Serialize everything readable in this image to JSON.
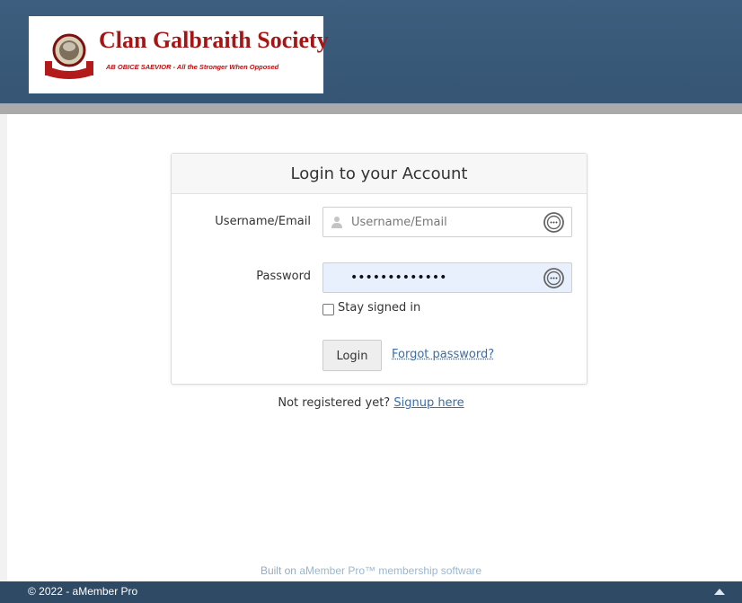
{
  "site": {
    "name": "Clan Galbraith Society",
    "motto": "AB OBICE SAEVIOR - All the Stronger When Opposed"
  },
  "login": {
    "title": "Login to your Account",
    "username_label": "Username/Email",
    "username_placeholder": "Username/Email",
    "password_label": "Password",
    "password_value": "•••••••••••••",
    "stay_signed_in": "Stay signed in",
    "login_button": "Login",
    "forgot_link": "Forgot password?"
  },
  "signup": {
    "prompt": "Not registered yet?",
    "link": "Signup here"
  },
  "built_on": {
    "prefix": "Built on",
    "product": "aMember Pro™ membership software"
  },
  "footer": {
    "copyright": "© 2022 - aMember Pro"
  },
  "colors": {
    "header": "#3d5e7e",
    "brand_red": "#a61515",
    "link": "#3b6ea5",
    "footer": "#2f4a64",
    "password_fill": "#e8f0fe"
  }
}
